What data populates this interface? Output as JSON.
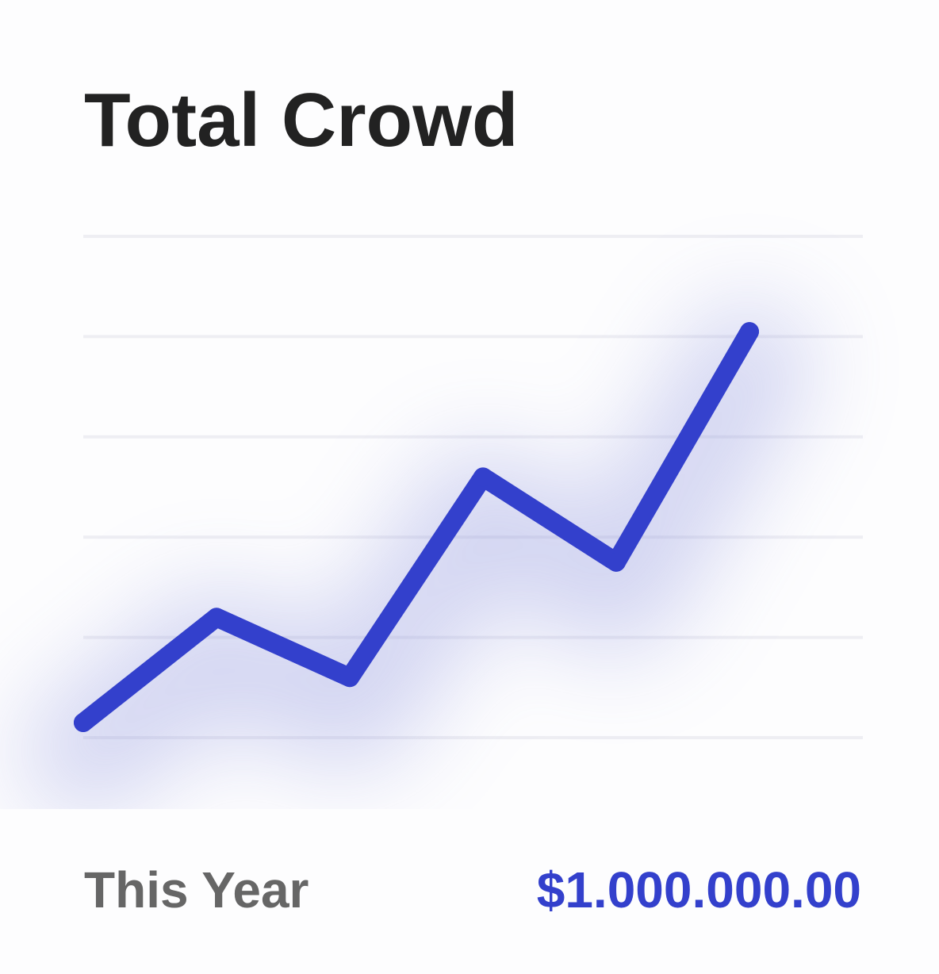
{
  "card": {
    "title": "Total Crowd",
    "footer_label": "This Year",
    "footer_value": "$1.000.000.00"
  },
  "colors": {
    "line": "#3340cc",
    "glow": "#7f86d9",
    "grid": "#eeeef3",
    "title": "#222222",
    "label": "#666666"
  },
  "chart_data": {
    "type": "line",
    "title": "",
    "xlabel": "",
    "ylabel": "",
    "grid": true,
    "gridlines": 6,
    "x": [
      0,
      1,
      2,
      3,
      4,
      5
    ],
    "ylim": [
      0,
      5
    ],
    "series": [
      {
        "values": [
          0.15,
          1.2,
          0.6,
          2.6,
          1.75,
          4.05
        ]
      }
    ]
  }
}
